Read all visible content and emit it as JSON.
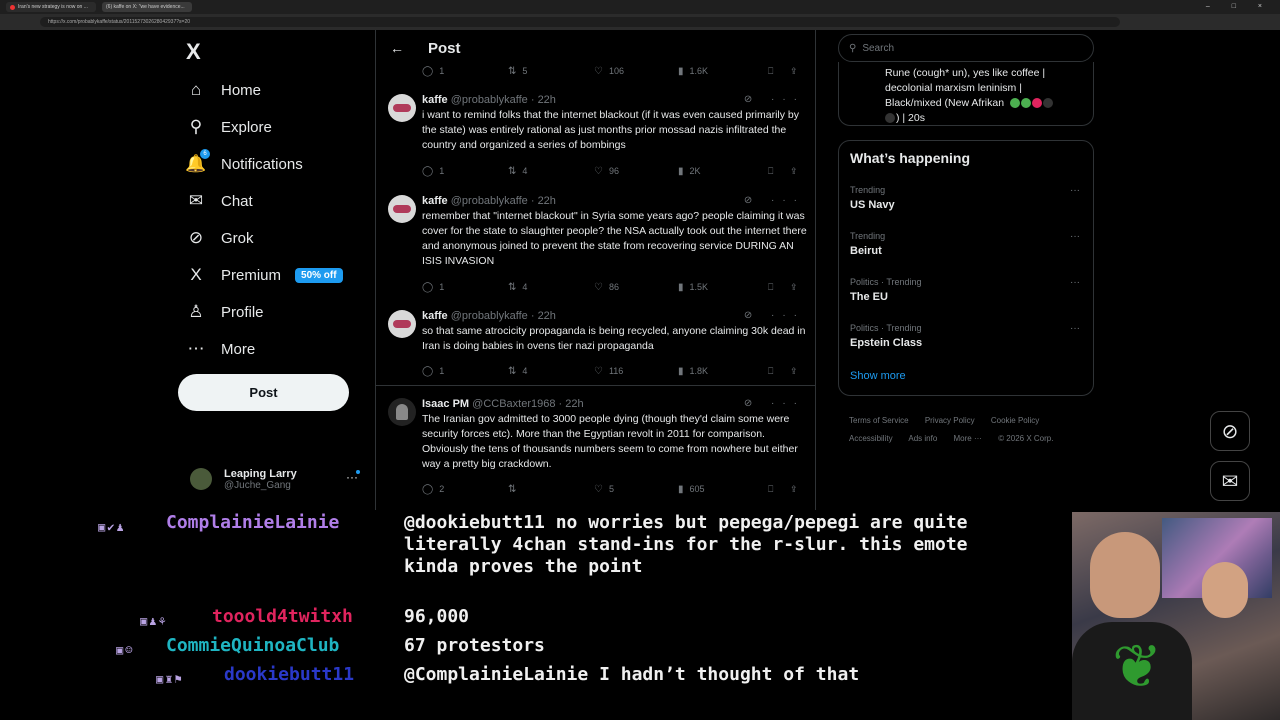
{
  "browser": {
    "tabs": [
      {
        "label": "Iran's new strategy is now on ..."
      },
      {
        "label": "(6) kaffe on X: \"we have evidence..."
      }
    ],
    "url": "https://x.com/probablykaffe/status/2011527302628042937?s=20",
    "window_controls": "– □ ×"
  },
  "nav": {
    "logo": "X",
    "items": [
      {
        "label": "Home",
        "icon": "⌂"
      },
      {
        "label": "Explore",
        "icon": "⚲"
      },
      {
        "label": "Notifications",
        "icon": "🔔",
        "badge": "6"
      },
      {
        "label": "Chat",
        "icon": "✉"
      },
      {
        "label": "Grok",
        "icon": "⊘"
      },
      {
        "label": "Premium",
        "icon": "X",
        "pill": "50% off"
      },
      {
        "label": "Profile",
        "icon": "♙"
      },
      {
        "label": "More",
        "icon": "⋯"
      }
    ],
    "post_button": "Post",
    "account": {
      "name": "Leaping Larry",
      "handle": "@Juche_Gang"
    }
  },
  "timeline": {
    "title": "Post",
    "back_icon": "←",
    "top_actions": {
      "reply": "1",
      "repost": "5",
      "like": "106",
      "views": "1.6K"
    },
    "tweets": [
      {
        "name": "kaffe",
        "handle": "@probablykaffe",
        "time": "22h",
        "text": "i want to remind folks that the internet blackout (if it was even caused primarily by the state) was entirely rational as just months prior mossad nazis infiltrated the country and organized a series of bombings",
        "reply": "1",
        "repost": "4",
        "like": "96",
        "views": "2K"
      },
      {
        "name": "kaffe",
        "handle": "@probablykaffe",
        "time": "22h",
        "text": "remember that \"internet blackout\" in Syria some years ago? people claiming it was cover for the state to slaughter people? the NSA actually took out the internet there and anonymous joined to prevent the state from recovering service DURING AN ISIS INVASION",
        "reply": "1",
        "repost": "4",
        "like": "86",
        "views": "1.5K"
      },
      {
        "name": "kaffe",
        "handle": "@probablykaffe",
        "time": "22h",
        "text": "so that same atrocicity propaganda is being recycled, anyone claiming 30k dead in Iran is doing babies in ovens tier nazi propaganda",
        "reply": "1",
        "repost": "4",
        "like": "116",
        "views": "1.8K"
      },
      {
        "name": "Isaac PM",
        "handle": "@CCBaxter1968",
        "time": "22h",
        "text": "The Iranian gov admitted to 3000 people dying (though they'd claim some were security forces etc). More than the Egyptian revolt in 2011 for comparison. Obviously the tens of thousands numbers seem to come from nowhere but either way a pretty big crackdown.",
        "reply": "2",
        "repost": "",
        "like": "5",
        "views": "605"
      }
    ]
  },
  "right": {
    "search_placeholder": "Search",
    "bio_line1": "Rune (cough* un), yes like coffee |",
    "bio_line2": "decolonial marxism leninism |",
    "bio_line3": "Black/mixed (New Afrikan",
    "bio_line4": ") | 20s",
    "bio_circles": [
      "#4caf50",
      "#4caf50",
      "#e0245e",
      "#333333",
      "#333333"
    ],
    "happening_title": "What’s happening",
    "trends": [
      {
        "context": "Trending",
        "name": "US Navy"
      },
      {
        "context": "Trending",
        "name": "Beirut"
      },
      {
        "context": "Politics · Trending",
        "name": "The EU"
      },
      {
        "context": "Politics · Trending",
        "name": "Epstein Class"
      }
    ],
    "show_more": "Show more",
    "footer": [
      "Terms of Service",
      "Privacy Policy",
      "Cookie Policy",
      "Accessibility",
      "Ads info",
      "More ···",
      "© 2026 X Corp."
    ]
  },
  "chat": [
    {
      "user": "ComplainieLainie",
      "color": "#b07ee8",
      "message": "@dookiebutt11 no worries but pepega/pepegi are quite literally 4chan stand-ins for the r-slur. this emote kinda proves the point"
    },
    {
      "user": "tooold4twitxh",
      "color": "#e0245e",
      "message": "96,000"
    },
    {
      "user": "CommieQuinoaClub",
      "color": "#1fb5c2",
      "message": "67 protestors"
    },
    {
      "user": "dookiebutt11",
      "color": "#2a39c9",
      "message": "@ComplainieLainie I hadn’t thought of that"
    }
  ],
  "colors": {
    "accent": "#1d9bf0",
    "background": "#000000",
    "border": "#2f3336"
  }
}
